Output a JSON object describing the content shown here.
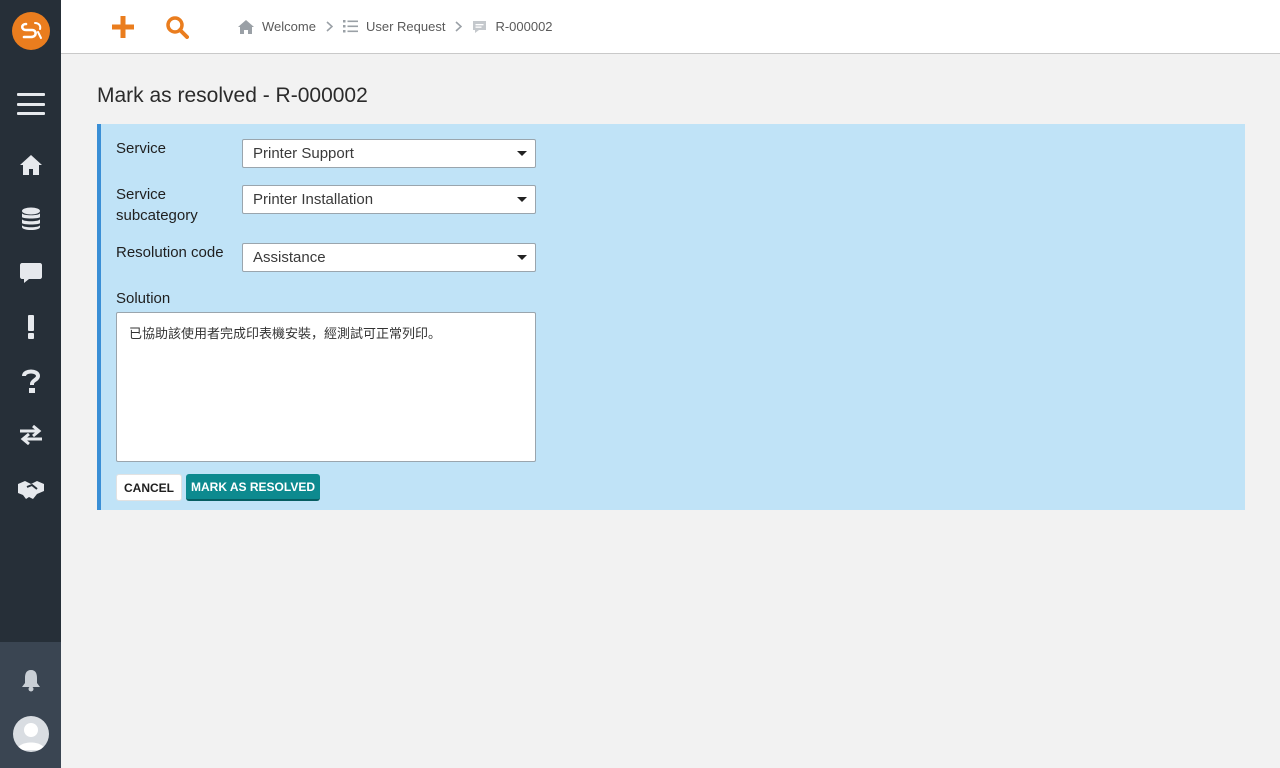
{
  "breadcrumb": {
    "items": [
      "Welcome",
      "User Request",
      "R-000002"
    ]
  },
  "page": {
    "title": "Mark as resolved - R-000002"
  },
  "form": {
    "service_label": "Service",
    "service_value": "Printer Support",
    "subcategory_label": "Service subcategory",
    "subcategory_value": "Printer Installation",
    "resolution_code_label": "Resolution code",
    "resolution_code_value": "Assistance",
    "solution_label": "Solution",
    "solution_value": "已協助該使用者完成印表機安裝，經測試可正常列印。",
    "cancel_label": "CANCEL",
    "resolve_label": "MARK AS RESOLVED"
  },
  "icons": {
    "sidebar": [
      "logo-icon",
      "menu-icon",
      "home-icon",
      "database-icon",
      "chat-icon",
      "exclamation-icon",
      "question-icon",
      "transfer-icon",
      "handshake-icon",
      "bell-icon",
      "avatar-icon"
    ],
    "topbar": [
      "plus-icon",
      "search-icon",
      "home-icon",
      "list-icon",
      "ticket-icon",
      "chevron-right-icon"
    ]
  },
  "colors": {
    "accent": "#ea7d1e",
    "sidebar": "#262f38",
    "panel": "#c0e3f7",
    "primary_button": "#0d8a8f"
  }
}
